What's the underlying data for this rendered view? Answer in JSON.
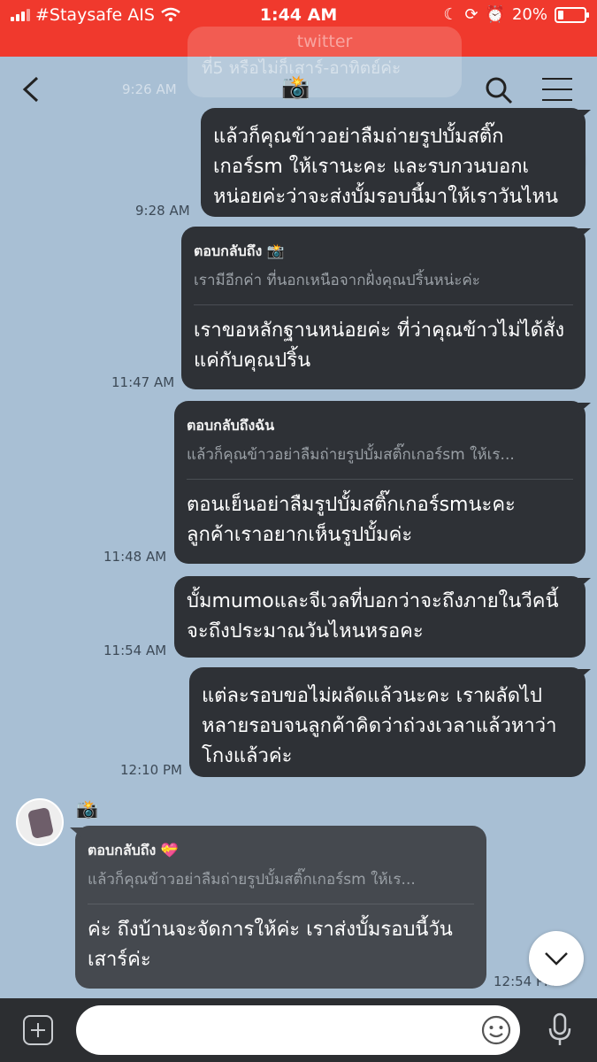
{
  "status_bar": {
    "carrier": "#Staysafe AIS",
    "time": "1:44 AM",
    "battery": "20%",
    "battery_level": 0.2
  },
  "header": {
    "ghost_sender": "twitter",
    "ghost_text": "ที่5 หรือไม่ก็เสาร์-อาทิตย์ค่ะ",
    "ghost_time": "9:26 AM",
    "title_icon": "camera-flash-icon"
  },
  "messages": [
    {
      "lines": [
        "แล้วก็คุณข้าวอย่าลืมถ่ายรูปบั้มสติ๊ก",
        "เกอร์sm ให้เรานะคะ และรบกวนบอกเ",
        "หน่อยค่ะว่าจะส่งบั้มรอบนี้มาให้เราวันไหน"
      ],
      "time": "9:28 AM"
    },
    {
      "reply_to": "ตอบกลับถึง 📸",
      "reply_text": "เรามีอีกค่า ที่นอกเหนือจากฝั่งคุณปริ้นหน่ะค่ะ",
      "lines": [
        "เราขอหลักฐานหน่อยค่ะ ที่ว่าคุณข้าวไม่ได้สั่ง",
        "แค่กับคุณปริ้น"
      ],
      "time": "11:47 AM"
    },
    {
      "reply_to": "ตอบกลับถึงฉัน",
      "reply_text": "แล้วก็คุณข้าวอย่าลืมถ่ายรูปบั้มสติ๊กเกอร์sm ให้เร...",
      "lines": [
        "ตอนเย็นอย่าลืมรูปบั้มสติ๊กเกอร์smนะคะ",
        "ลูกค้าเราอยากเห็นรูปบั้มค่ะ"
      ],
      "time": "11:48 AM"
    },
    {
      "lines": [
        "บั้มmumoและจีเวลที่บอกว่าจะถึงภายในวีคนี้",
        "จะถึงประมาณวันไหนหรอคะ"
      ],
      "time": "11:54 AM"
    },
    {
      "lines": [
        "แต่ละรอบขอไม่ผลัดแล้วนะคะ เราผลัดไป",
        "หลายรอบจนลูกค้าคิดว่าถ่วงเวลาแล้วหาว่า",
        "โกงแล้วค่ะ"
      ],
      "time": "12:10 PM"
    }
  ],
  "incoming": {
    "sender": "📸",
    "reply_to": "ตอบกลับถึง 💝",
    "reply_text": "แล้วก็คุณข้าวอย่าลืมถ่ายรูปบั้มสติ๊กเกอร์sm ให้เร...",
    "lines": [
      "ค่ะ ถึงบ้านจะจัดการให้ค่ะ เราส่งบั้มรอบนี้วัน",
      "เสาร์ค่ะ"
    ],
    "time": "12:54 PM"
  },
  "input": {
    "value": "",
    "placeholder": ""
  },
  "colors": {
    "status_bar": "#f0392d",
    "chat_background": "#a8bfd4",
    "outgoing_bubble": "#2e3136",
    "incoming_bubble": "#45494f"
  }
}
